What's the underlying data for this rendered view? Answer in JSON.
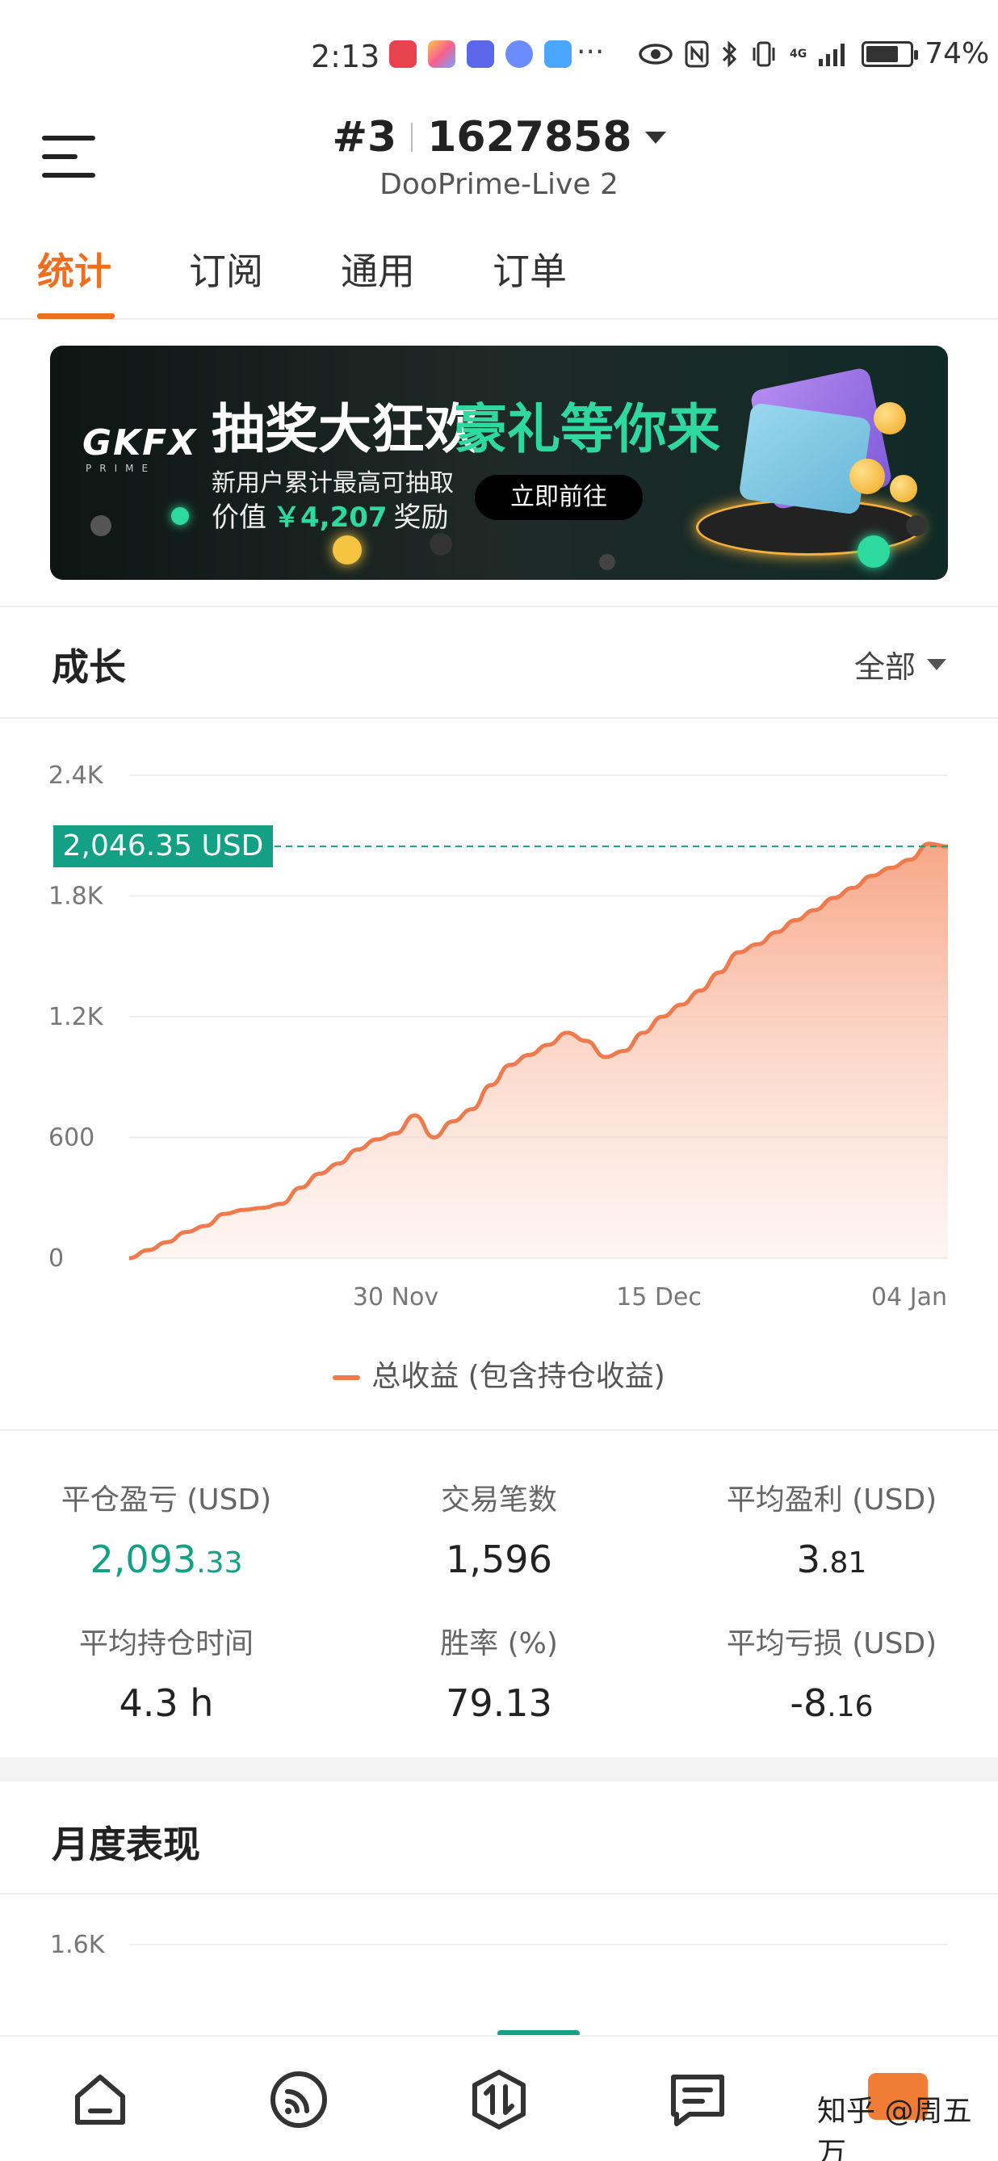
{
  "status_bar": {
    "time": "2:13",
    "more": "···",
    "network": "4G",
    "battery_percent": "74%",
    "battery_level": 0.74
  },
  "header": {
    "account_rank": "#3",
    "account_id": "1627858",
    "server": "DooPrime-Live 2"
  },
  "tabs": [
    {
      "label": "统计",
      "active": true
    },
    {
      "label": "订阅",
      "active": false
    },
    {
      "label": "通用",
      "active": false
    },
    {
      "label": "订单",
      "active": false
    }
  ],
  "banner": {
    "logo": "GKFX",
    "logo_sub": "PRIME",
    "headline_white": "抽奖大狂欢",
    "headline_green": "豪礼等你来",
    "line1": "新用户累计最高可抽取",
    "line2_prefix": "价值",
    "line2_amount": "￥4,207",
    "line2_suffix": "奖励",
    "cta": "立即前往"
  },
  "growth": {
    "title": "成长",
    "filter": "全部",
    "current_value_label": "2,046.35 USD",
    "legend": "总收益 (包含持仓收益)"
  },
  "chart_data": {
    "type": "area",
    "yticks": [
      "2.4K",
      "1.8K",
      "1.2K",
      "600",
      "0"
    ],
    "ylim": [
      0,
      2400
    ],
    "xticks": [
      "30 Nov",
      "15 Dec",
      "04 Jan"
    ],
    "current_value": 2046.35,
    "series": [
      {
        "name": "总收益 (包含持仓收益)",
        "values": [
          0,
          40,
          80,
          130,
          160,
          220,
          240,
          250,
          270,
          350,
          420,
          470,
          540,
          590,
          620,
          710,
          600,
          680,
          740,
          860,
          960,
          1010,
          1060,
          1120,
          1080,
          1000,
          1030,
          1120,
          1200,
          1260,
          1330,
          1420,
          1520,
          1560,
          1620,
          1680,
          1730,
          1790,
          1840,
          1900,
          1940,
          1980,
          2060,
          2046
        ]
      }
    ],
    "color": "#f07a4b"
  },
  "stats": [
    {
      "label": "平仓盈亏 (USD)",
      "int": "2,093",
      "dec": ".33",
      "green": true
    },
    {
      "label": "交易笔数",
      "int": "1,596",
      "dec": "",
      "green": false
    },
    {
      "label": "平均盈利 (USD)",
      "int": "3",
      "dec": ".81",
      "green": false
    },
    {
      "label": "平均持仓时间",
      "int": "4.3 h",
      "dec": "",
      "green": false
    },
    {
      "label": "胜率 (%)",
      "int": "79.13",
      "dec": "",
      "green": false
    },
    {
      "label": "平均亏损 (USD)",
      "int": "-8",
      "dec": ".16",
      "green": false
    }
  ],
  "monthly": {
    "title": "月度表现",
    "first_tick": "1.6K"
  },
  "watermark": "知乎 @周五万",
  "colors": {
    "accent": "#f06e1f",
    "green": "#14a085",
    "line": "#f07a4b"
  }
}
